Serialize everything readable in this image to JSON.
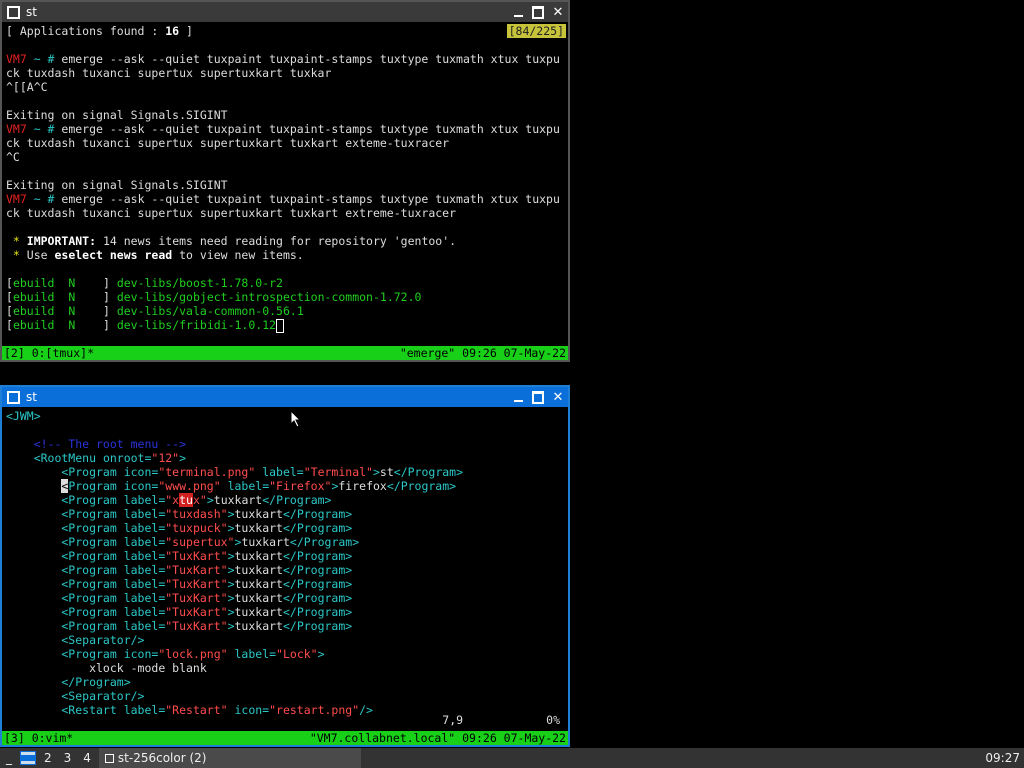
{
  "top_window": {
    "title": "st",
    "buttons": {
      "minimize": "_",
      "maximize": "□",
      "close": "✕"
    },
    "counter": "[84/225]",
    "lines": [
      {
        "parts": [
          {
            "t": "[ Applications found : ",
            "c": ""
          },
          {
            "t": "16",
            "c": "bold"
          },
          {
            "t": " ]",
            "c": ""
          }
        ]
      },
      {
        "parts": []
      },
      {
        "parts": [
          {
            "t": "VM7",
            "c": "red"
          },
          {
            "t": " ~ # ",
            "c": "cyan"
          },
          {
            "t": "emerge --ask --quiet tuxpaint tuxpaint-stamps tuxtype tuxmath xtux tuxpu",
            "c": ""
          }
        ]
      },
      {
        "parts": [
          {
            "t": "ck tuxdash tuxanci supertux supertuxkart tuxkar",
            "c": ""
          }
        ]
      },
      {
        "parts": [
          {
            "t": "^[[A^C",
            "c": ""
          }
        ]
      },
      {
        "parts": []
      },
      {
        "parts": [
          {
            "t": "Exiting on signal Signals.SIGINT",
            "c": ""
          }
        ]
      },
      {
        "parts": [
          {
            "t": "VM7",
            "c": "red"
          },
          {
            "t": " ~ # ",
            "c": "cyan"
          },
          {
            "t": "emerge --ask --quiet tuxpaint tuxpaint-stamps tuxtype tuxmath xtux tuxpu",
            "c": ""
          }
        ]
      },
      {
        "parts": [
          {
            "t": "ck tuxdash tuxanci supertux supertuxkart tuxkart exteme-tuxracer",
            "c": ""
          }
        ]
      },
      {
        "parts": [
          {
            "t": "^C",
            "c": ""
          }
        ]
      },
      {
        "parts": []
      },
      {
        "parts": [
          {
            "t": "Exiting on signal Signals.SIGINT",
            "c": ""
          }
        ]
      },
      {
        "parts": [
          {
            "t": "VM7",
            "c": "red"
          },
          {
            "t": " ~ # ",
            "c": "cyan"
          },
          {
            "t": "emerge --ask --quiet tuxpaint tuxpaint-stamps tuxtype tuxmath xtux tuxpu",
            "c": ""
          }
        ]
      },
      {
        "parts": [
          {
            "t": "ck tuxdash tuxanci supertux supertuxkart tuxkart extreme-tuxracer",
            "c": ""
          }
        ]
      },
      {
        "parts": []
      },
      {
        "parts": [
          {
            "t": " * ",
            "c": "yellow"
          },
          {
            "t": "IMPORTANT:",
            "c": "yellow bold"
          },
          {
            "t": " 14 news items need reading for repository 'gentoo'.",
            "c": ""
          }
        ]
      },
      {
        "parts": [
          {
            "t": " * ",
            "c": "yellow"
          },
          {
            "t": "Use ",
            "c": ""
          },
          {
            "t": "eselect news read",
            "c": "ltgreen bold"
          },
          {
            "t": " to view new items.",
            "c": ""
          }
        ]
      },
      {
        "parts": []
      },
      {
        "parts": [
          {
            "t": "[",
            "c": ""
          },
          {
            "t": "ebuild  N    ",
            "c": "green"
          },
          {
            "t": "] ",
            "c": ""
          },
          {
            "t": "dev-libs/boost-1.78.0-r2",
            "c": "green"
          }
        ]
      },
      {
        "parts": [
          {
            "t": "[",
            "c": ""
          },
          {
            "t": "ebuild  N    ",
            "c": "green"
          },
          {
            "t": "] ",
            "c": ""
          },
          {
            "t": "dev-libs/gobject-introspection-common-1.72.0",
            "c": "green"
          }
        ]
      },
      {
        "parts": [
          {
            "t": "[",
            "c": ""
          },
          {
            "t": "ebuild  N    ",
            "c": "green"
          },
          {
            "t": "] ",
            "c": ""
          },
          {
            "t": "dev-libs/vala-common-0.56.1",
            "c": "green"
          }
        ]
      },
      {
        "parts": [
          {
            "t": "[",
            "c": ""
          },
          {
            "t": "ebuild  N    ",
            "c": "green"
          },
          {
            "t": "] ",
            "c": ""
          },
          {
            "t": "dev-libs/fribidi-1.0.12",
            "c": "green"
          },
          {
            "t": "",
            "c": "cursorbox"
          }
        ]
      }
    ],
    "status_left": "[2] 0:[tmux]*",
    "status_right": "\"emerge\" 09:26 07-May-22"
  },
  "bottom_window": {
    "title": "st",
    "buttons": {
      "minimize": "_",
      "maximize": "□",
      "close": "✕"
    },
    "lines": [
      {
        "parts": [
          {
            "t": "<JWM>",
            "c": "cyan"
          }
        ]
      },
      {
        "parts": []
      },
      {
        "parts": [
          {
            "t": "    <!-- The root menu -->",
            "c": "blue"
          }
        ]
      },
      {
        "parts": [
          {
            "t": "    <RootMenu ",
            "c": "cyan"
          },
          {
            "t": "onroot=",
            "c": "cyan"
          },
          {
            "t": "\"12\"",
            "c": "pink"
          },
          {
            "t": ">",
            "c": "cyan"
          }
        ]
      },
      {
        "parts": [
          {
            "t": "        <Program ",
            "c": "cyan"
          },
          {
            "t": "icon=",
            "c": "cyan"
          },
          {
            "t": "\"terminal.png\"",
            "c": "pink"
          },
          {
            "t": " label=",
            "c": "cyan"
          },
          {
            "t": "\"Terminal\"",
            "c": "pink"
          },
          {
            "t": ">",
            "c": "cyan"
          },
          {
            "t": "st",
            "c": ""
          },
          {
            "t": "</Program>",
            "c": "cyan"
          }
        ]
      },
      {
        "parts": [
          {
            "t": "        ",
            "c": ""
          },
          {
            "t": "<",
            "c": "cursorblk"
          },
          {
            "t": "Program ",
            "c": "cyan"
          },
          {
            "t": "icon=",
            "c": "cyan"
          },
          {
            "t": "\"www.png\"",
            "c": "pink"
          },
          {
            "t": " label=",
            "c": "cyan"
          },
          {
            "t": "\"Firefox\"",
            "c": "pink"
          },
          {
            "t": ">",
            "c": "cyan"
          },
          {
            "t": "firefox",
            "c": ""
          },
          {
            "t": "</Program>",
            "c": "cyan"
          }
        ]
      },
      {
        "parts": [
          {
            "t": "        <Program ",
            "c": "cyan"
          },
          {
            "t": "label=",
            "c": "cyan"
          },
          {
            "t": "\"x",
            "c": "pink"
          },
          {
            "t": "tu",
            "c": "hl"
          },
          {
            "t": "x\"",
            "c": "pink"
          },
          {
            "t": ">",
            "c": "cyan"
          },
          {
            "t": "tuxkart",
            "c": ""
          },
          {
            "t": "</Program>",
            "c": "cyan"
          }
        ]
      },
      {
        "parts": [
          {
            "t": "        <Program ",
            "c": "cyan"
          },
          {
            "t": "label=",
            "c": "cyan"
          },
          {
            "t": "\"tuxdash\"",
            "c": "pink"
          },
          {
            "t": ">",
            "c": "cyan"
          },
          {
            "t": "tuxkart",
            "c": ""
          },
          {
            "t": "</Program>",
            "c": "cyan"
          }
        ]
      },
      {
        "parts": [
          {
            "t": "        <Program ",
            "c": "cyan"
          },
          {
            "t": "label=",
            "c": "cyan"
          },
          {
            "t": "\"tuxpuck\"",
            "c": "pink"
          },
          {
            "t": ">",
            "c": "cyan"
          },
          {
            "t": "tuxkart",
            "c": ""
          },
          {
            "t": "</Program>",
            "c": "cyan"
          }
        ]
      },
      {
        "parts": [
          {
            "t": "        <Program ",
            "c": "cyan"
          },
          {
            "t": "label=",
            "c": "cyan"
          },
          {
            "t": "\"supertux\"",
            "c": "pink"
          },
          {
            "t": ">",
            "c": "cyan"
          },
          {
            "t": "tuxkart",
            "c": ""
          },
          {
            "t": "</Program>",
            "c": "cyan"
          }
        ]
      },
      {
        "parts": [
          {
            "t": "        <Program ",
            "c": "cyan"
          },
          {
            "t": "label=",
            "c": "cyan"
          },
          {
            "t": "\"TuxKart\"",
            "c": "pink"
          },
          {
            "t": ">",
            "c": "cyan"
          },
          {
            "t": "tuxkart",
            "c": ""
          },
          {
            "t": "</Program>",
            "c": "cyan"
          }
        ]
      },
      {
        "parts": [
          {
            "t": "        <Program ",
            "c": "cyan"
          },
          {
            "t": "label=",
            "c": "cyan"
          },
          {
            "t": "\"TuxKart\"",
            "c": "pink"
          },
          {
            "t": ">",
            "c": "cyan"
          },
          {
            "t": "tuxkart",
            "c": ""
          },
          {
            "t": "</Program>",
            "c": "cyan"
          }
        ]
      },
      {
        "parts": [
          {
            "t": "        <Program ",
            "c": "cyan"
          },
          {
            "t": "label=",
            "c": "cyan"
          },
          {
            "t": "\"TuxKart\"",
            "c": "pink"
          },
          {
            "t": ">",
            "c": "cyan"
          },
          {
            "t": "tuxkart",
            "c": ""
          },
          {
            "t": "</Program>",
            "c": "cyan"
          }
        ]
      },
      {
        "parts": [
          {
            "t": "        <Program ",
            "c": "cyan"
          },
          {
            "t": "label=",
            "c": "cyan"
          },
          {
            "t": "\"TuxKart\"",
            "c": "pink"
          },
          {
            "t": ">",
            "c": "cyan"
          },
          {
            "t": "tuxkart",
            "c": ""
          },
          {
            "t": "</Program>",
            "c": "cyan"
          }
        ]
      },
      {
        "parts": [
          {
            "t": "        <Program ",
            "c": "cyan"
          },
          {
            "t": "label=",
            "c": "cyan"
          },
          {
            "t": "\"TuxKart\"",
            "c": "pink"
          },
          {
            "t": ">",
            "c": "cyan"
          },
          {
            "t": "tuxkart",
            "c": ""
          },
          {
            "t": "</Program>",
            "c": "cyan"
          }
        ]
      },
      {
        "parts": [
          {
            "t": "        <Program ",
            "c": "cyan"
          },
          {
            "t": "label=",
            "c": "cyan"
          },
          {
            "t": "\"TuxKart\"",
            "c": "pink"
          },
          {
            "t": ">",
            "c": "cyan"
          },
          {
            "t": "tuxkart",
            "c": ""
          },
          {
            "t": "</Program>",
            "c": "cyan"
          }
        ]
      },
      {
        "parts": [
          {
            "t": "        <Separator/>",
            "c": "cyan"
          }
        ]
      },
      {
        "parts": [
          {
            "t": "        <Program ",
            "c": "cyan"
          },
          {
            "t": "icon=",
            "c": "cyan"
          },
          {
            "t": "\"lock.png\"",
            "c": "pink"
          },
          {
            "t": " label=",
            "c": "cyan"
          },
          {
            "t": "\"Lock\"",
            "c": "pink"
          },
          {
            "t": ">",
            "c": "cyan"
          }
        ]
      },
      {
        "parts": [
          {
            "t": "            xlock -mode blank",
            "c": ""
          }
        ]
      },
      {
        "parts": [
          {
            "t": "        </Program>",
            "c": "cyan"
          }
        ]
      },
      {
        "parts": [
          {
            "t": "        <Separator/>",
            "c": "cyan"
          }
        ]
      },
      {
        "parts": [
          {
            "t": "        <Restart ",
            "c": "cyan"
          },
          {
            "t": "label=",
            "c": "cyan"
          },
          {
            "t": "\"Restart\"",
            "c": "pink"
          },
          {
            "t": " icon=",
            "c": "cyan"
          },
          {
            "t": "\"restart.png\"",
            "c": "pink"
          },
          {
            "t": "/>",
            "c": "cyan"
          }
        ]
      }
    ],
    "ruler": "7,9            0%",
    "status_left": "[3] 0:vim*",
    "status_right": "\"VM7.collabnet.local\" 09:26 07-May-22"
  },
  "taskbar": {
    "root_menu": "_",
    "desktops": [
      "2",
      "3",
      "4"
    ],
    "task_label": "st-256color (2)",
    "clock": "09:27"
  },
  "colors": {
    "top_status": "#19d019",
    "active_title": "#0a6fd8",
    "inactive_title": "#3a3a3a"
  }
}
